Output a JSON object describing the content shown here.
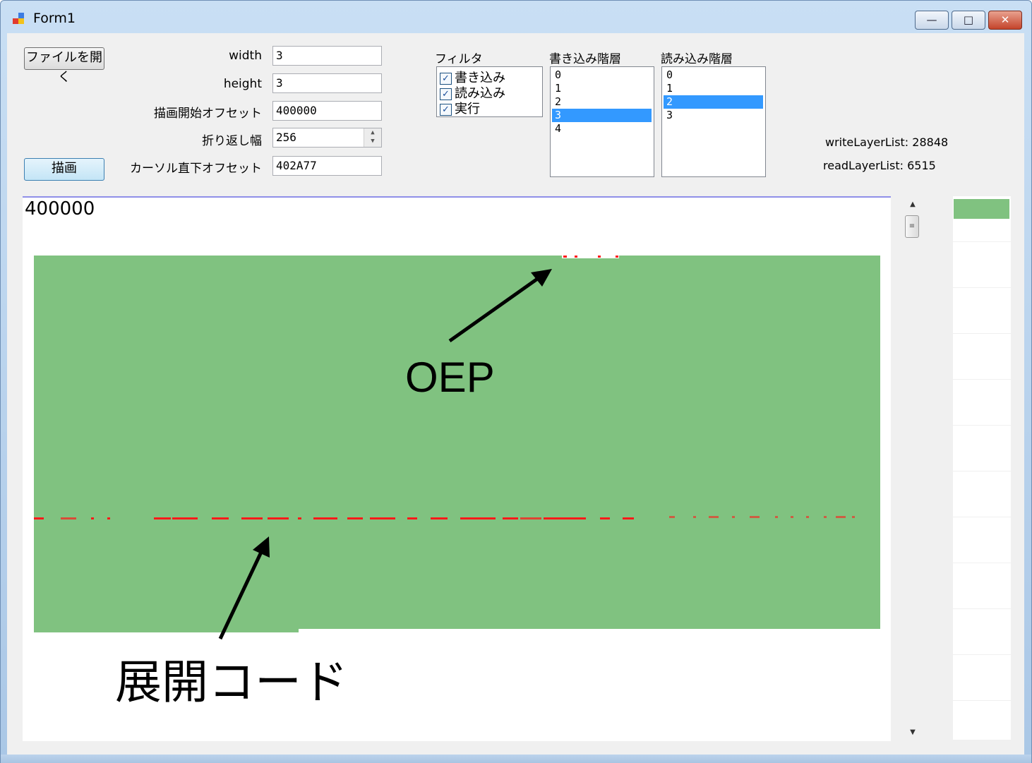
{
  "window": {
    "title": "Form1",
    "caption_buttons": {
      "minimize": "—",
      "maximize": "□",
      "close": "✕"
    }
  },
  "toolbar": {
    "open_file_label": "ファイルを開く",
    "draw_label": "描画"
  },
  "fields": {
    "width_label": "width",
    "width_value": "3",
    "height_label": "height",
    "height_value": "3",
    "draw_start_offset_label": "描画開始オフセット",
    "draw_start_offset_value": "400000",
    "wrap_width_label": "折り返し幅",
    "wrap_width_value": "256",
    "cursor_offset_label": "カーソル直下オフセット",
    "cursor_offset_value": "402A77"
  },
  "filter": {
    "label": "フィルタ",
    "items": [
      {
        "label": "書き込み",
        "checked": true
      },
      {
        "label": "読み込み",
        "checked": true
      },
      {
        "label": "実行",
        "checked": true
      }
    ]
  },
  "write_layers": {
    "label": "書き込み階層",
    "items": [
      "0",
      "1",
      "2",
      "3",
      "4"
    ],
    "selected": "3"
  },
  "read_layers": {
    "label": "読み込み階層",
    "items": [
      "0",
      "1",
      "2",
      "3"
    ],
    "selected": "2"
  },
  "stats": {
    "write_layer_list": "writeLayerList: 28848",
    "read_layer_list": "readLayerList: 6515"
  },
  "canvas": {
    "offset_text": "400000",
    "fill_color": "#80c280",
    "mark_color": "#ff1a1a"
  },
  "annotations": {
    "oep": "OEP",
    "unpacked_code": "展開コード"
  },
  "colors": {
    "selection": "#3399ff",
    "canvas_border": "#8f8fe8"
  }
}
